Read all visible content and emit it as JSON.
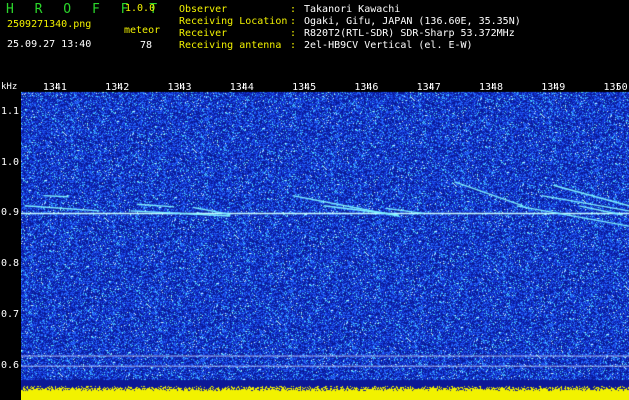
{
  "header": {
    "app_title": "H R O F F T",
    "app_version": "1.0.0",
    "file_name": "2509271340.png",
    "date_time": "25.09.27 13:40",
    "meteor_label": "meteor",
    "meteor_count": "78",
    "info": [
      {
        "label": "Observer",
        "value": "Takanori Kawachi"
      },
      {
        "label": "Receiving Location",
        "value": "Ogaki, Gifu, JAPAN (136.60E, 35.35N)"
      },
      {
        "label": "Receiver",
        "value": "R820T2(RTL-SDR) SDR-Sharp 53.372MHz"
      },
      {
        "label": "Receiving antenna",
        "value": "2el-HB9CV Vertical (el. E-W)"
      }
    ],
    "separator": ":"
  },
  "spectrogram": {
    "y_unit": "kHz",
    "y_ticks": [
      "1.1",
      "1.0",
      "0.9",
      "0.8",
      "0.7",
      "0.6"
    ],
    "y_tick_values": [
      1.1,
      1.0,
      0.9,
      0.8,
      0.7,
      0.6
    ],
    "x_ticks": [
      "1341",
      "1342",
      "1343",
      "1344",
      "1345",
      "1346",
      "1347",
      "1348",
      "1349",
      "1350"
    ],
    "x_tick_values": [
      1341,
      1342,
      1343,
      1344,
      1345,
      1346,
      1347,
      1348,
      1349,
      1350
    ],
    "x_range": [
      1340.44,
      1350.2
    ],
    "y_range": [
      0.56,
      1.155
    ],
    "carrier_khz": 0.9,
    "colors": {
      "background": "#000000",
      "noise_dark": "#0a1a8c",
      "noise_mid": "#1a3acf",
      "noise_bright": "#3c7bff",
      "speck": "#55e6ff",
      "carrier": "#c8ffff",
      "streak": "#7ff2ff",
      "baseline": "#f2f200",
      "green_text": "#2bd62b",
      "yellow_text": "#f2f200"
    },
    "meteor_streaks": [
      {
        "t0": 1340.8,
        "f0": 0.935,
        "t1": 1341.2,
        "f1": 0.933
      },
      {
        "t0": 1340.5,
        "f0": 0.915,
        "t1": 1341.7,
        "f1": 0.905
      },
      {
        "t0": 1342.3,
        "f0": 0.918,
        "t1": 1342.9,
        "f1": 0.913
      },
      {
        "t0": 1342.2,
        "f0": 0.905,
        "t1": 1343.8,
        "f1": 0.895
      },
      {
        "t0": 1343.2,
        "f0": 0.912,
        "t1": 1343.8,
        "f1": 0.898
      },
      {
        "t0": 1344.8,
        "f0": 0.935,
        "t1": 1346.5,
        "f1": 0.895
      },
      {
        "t0": 1345.3,
        "f0": 0.915,
        "t1": 1346.5,
        "f1": 0.897
      },
      {
        "t0": 1346.3,
        "f0": 0.91,
        "t1": 1346.9,
        "f1": 0.9
      },
      {
        "t0": 1347.4,
        "f0": 0.962,
        "t1": 1348.5,
        "f1": 0.915
      },
      {
        "t0": 1348.4,
        "f0": 0.915,
        "t1": 1350.2,
        "f1": 0.875
      },
      {
        "t0": 1348.8,
        "f0": 0.935,
        "t1": 1350.2,
        "f1": 0.905
      },
      {
        "t0": 1349.0,
        "f0": 0.955,
        "t1": 1350.2,
        "f1": 0.915
      },
      {
        "t0": 1349.4,
        "f0": 0.915,
        "t1": 1350.1,
        "f1": 0.897
      }
    ],
    "horizontal_lines_khz": [
      0.62,
      0.6
    ]
  }
}
